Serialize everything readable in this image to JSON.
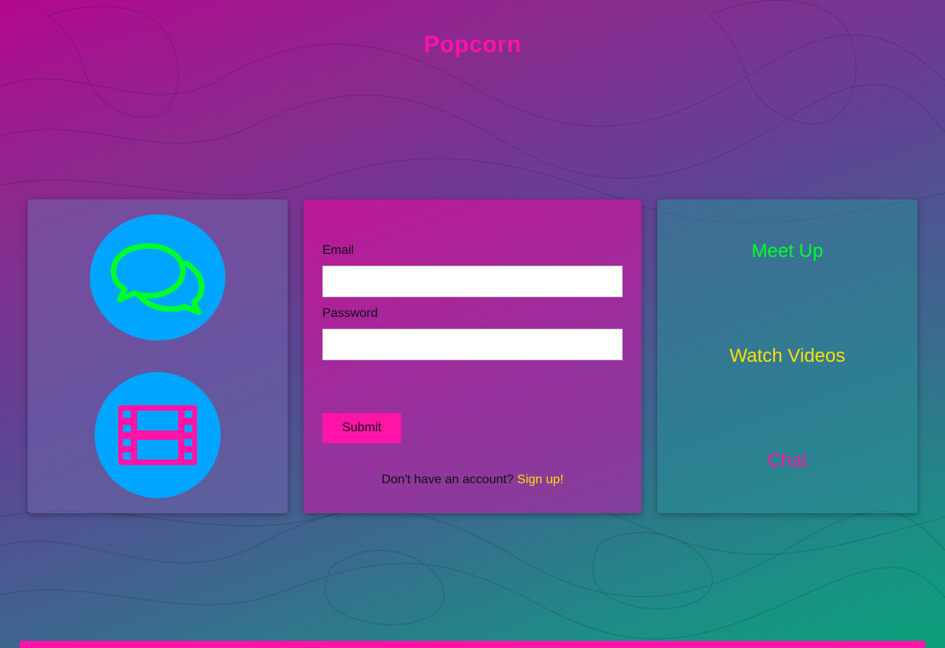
{
  "app": {
    "title": "Popcorn",
    "accent_color": "#ff14a8"
  },
  "left_panel": {
    "icons": [
      {
        "name": "chat-bubbles-icon",
        "color": "#00ff2a",
        "background": "#00a5ff"
      },
      {
        "name": "film-strip-icon",
        "color": "#ff14a8",
        "background": "#00a5ff"
      }
    ]
  },
  "login_form": {
    "email_label": "Email",
    "email_value": "",
    "password_label": "Password",
    "password_value": "",
    "submit_label": "Submit",
    "signup_prompt": "Don't have an account?",
    "signup_link": "Sign up!"
  },
  "features": {
    "items": [
      {
        "label": "Meet Up",
        "color": "#00ff2a"
      },
      {
        "label": "Watch Videos",
        "color": "#ffe000"
      },
      {
        "label": "Chat",
        "color": "#ff14a8"
      }
    ]
  }
}
